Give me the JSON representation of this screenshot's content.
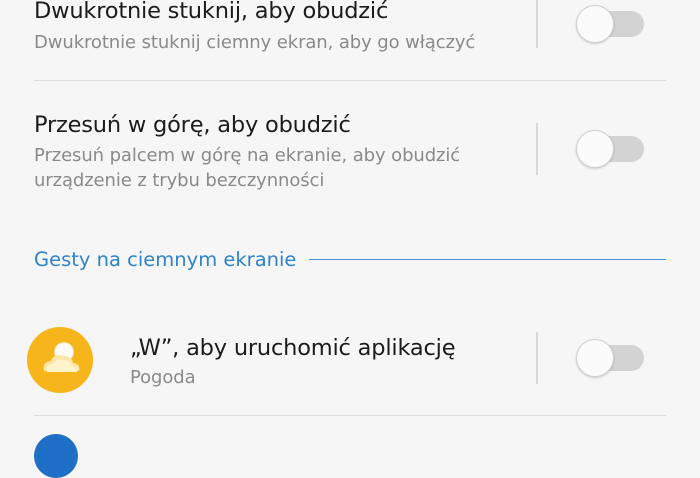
{
  "settings": [
    {
      "title": "Dwukrotnie stuknij, aby obudzić",
      "subtitle_lines": [
        "Dwukrotnie stuknij ciemny ekran, aby go włączyć"
      ],
      "enabled": false
    },
    {
      "title": "Przesuń w górę, aby obudzić",
      "subtitle_lines": [
        "Przesuń palcem w górę na ekranie, aby obudzić",
        "urządzenie z trybu bezczynności"
      ],
      "enabled": false
    }
  ],
  "section": {
    "label": "Gesty na ciemnym ekranie"
  },
  "gestures": [
    {
      "title": "„W”, aby uruchomić aplikację",
      "app": "Pogoda",
      "icon": "weather-app-icon",
      "enabled": false
    }
  ],
  "colors": {
    "accent": "#2f83c9",
    "weather_icon_bg": "#f7b51c",
    "toggle_off_track": "#d3d3d3"
  }
}
